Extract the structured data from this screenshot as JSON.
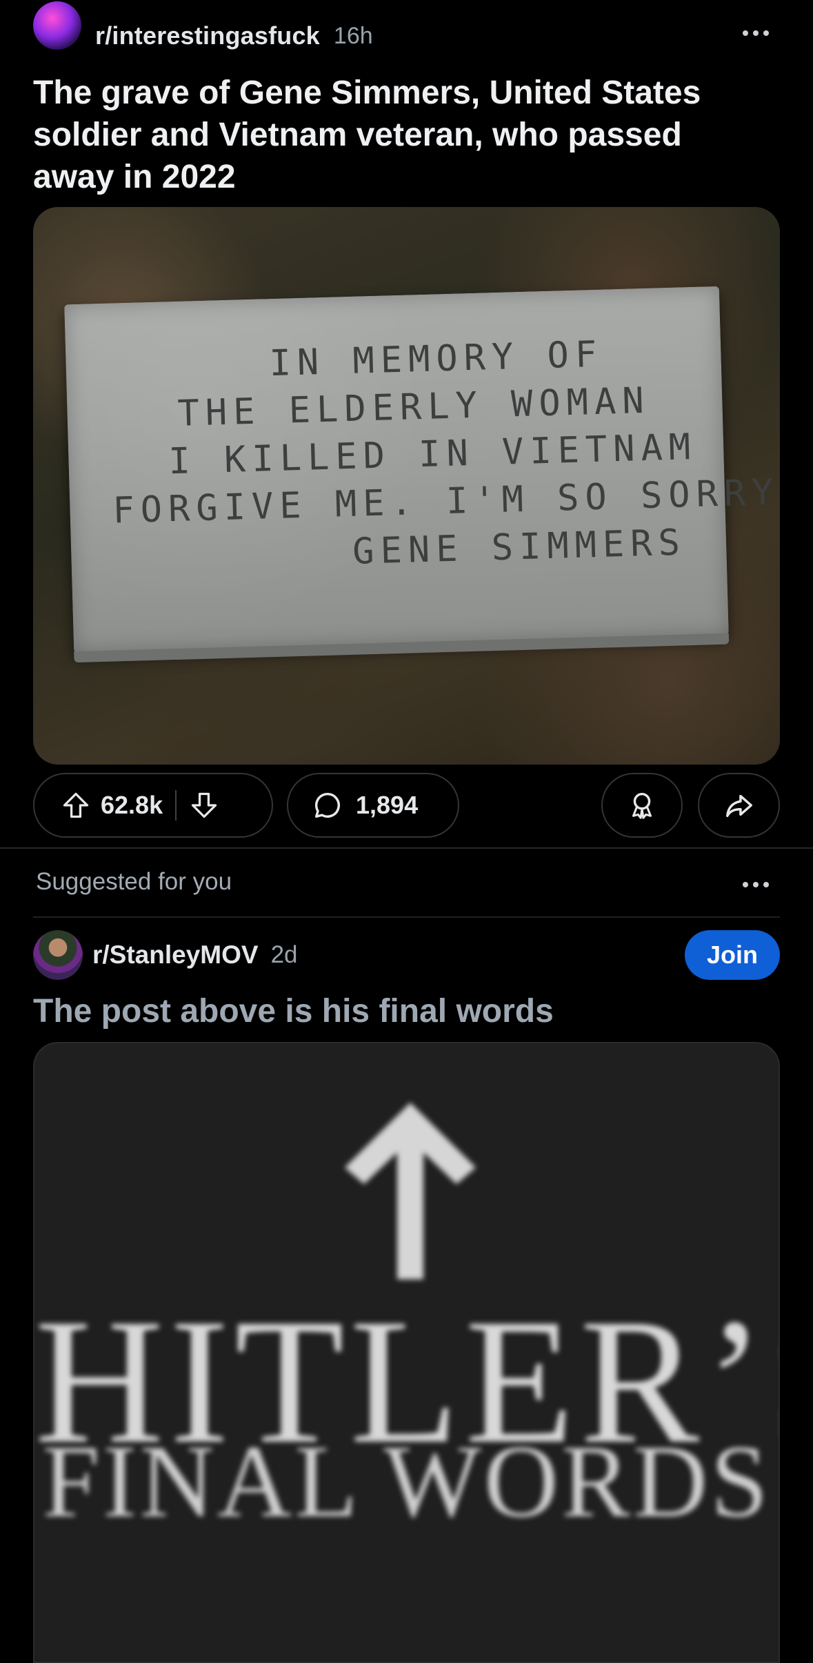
{
  "post": {
    "subreddit": "r/interestingasfuck",
    "age": "16h",
    "title": "The grave of Gene Simmers, United States soldier and Vietnam veteran, who passed away in 2022",
    "image": {
      "description_icon": "gravestone-photo",
      "inscription": [
        "In memory of",
        "the elderly woman",
        "I killed in Vietnam",
        "Forgive me. I'm so sorry",
        "Gene Simmers"
      ]
    },
    "actions": {
      "upvotes": "62.8k",
      "comments": "1,894"
    }
  },
  "suggested": {
    "label": "Suggested for you"
  },
  "post2": {
    "subreddit": "r/StanleyMOV",
    "age": "2d",
    "join_label": "Join",
    "title": "The post above is his final words",
    "image": {
      "line1": "HITLER’S",
      "line2": "FINAL WORDS"
    }
  },
  "colors": {
    "background": "#000000",
    "join_button": "#0f5fd6",
    "pill_border": "#343536"
  }
}
